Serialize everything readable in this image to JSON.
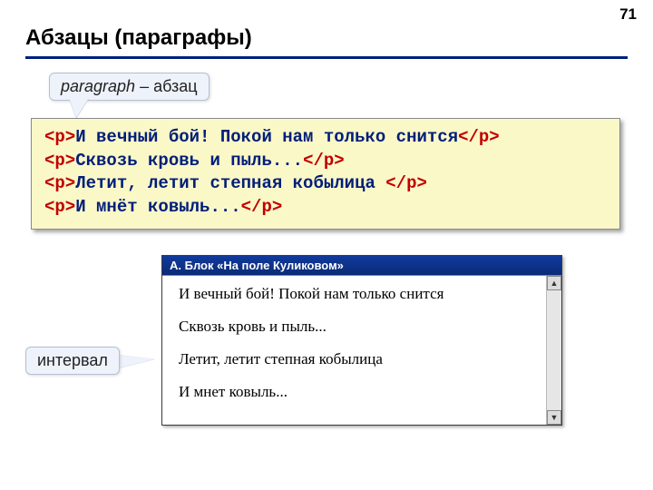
{
  "page_number": "71",
  "heading": "Абзацы (параграфы)",
  "callout_top": {
    "italic": "paragraph",
    "rest": " – абзац"
  },
  "callout_left": "интервал",
  "code": {
    "tag_open": "<p>",
    "tag_close": "</p>",
    "lines": [
      "И вечный бой! Покой нам только снится",
      "Сквозь кровь и пыль...",
      "Летит, летит степная кобылица ",
      "И мнёт ковыль..."
    ]
  },
  "window": {
    "title": "А. Блок «На поле Куликовом»",
    "paragraphs": [
      "И вечный бой! Покой нам только снится",
      "Сквозь кровь и пыль...",
      "Летит, летит степная кобылица",
      "И мнет ковыль..."
    ]
  },
  "glyphs": {
    "up": "▲",
    "down": "▼"
  }
}
